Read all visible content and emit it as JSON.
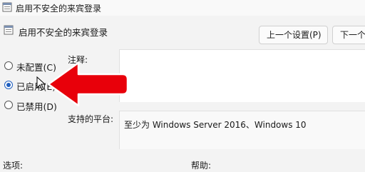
{
  "window": {
    "title": "启用不安全的来宾登录"
  },
  "header": {
    "title": "启用不安全的来宾登录"
  },
  "nav": {
    "prev_label": "上一个设置(P)",
    "next_label": "下一个"
  },
  "state": {
    "options": [
      {
        "label": "未配置(C)",
        "selected": false
      },
      {
        "label": "已启用(E)",
        "selected": true
      },
      {
        "label": "已禁用(D)",
        "selected": false
      }
    ]
  },
  "comment": {
    "label": "注释:",
    "value": ""
  },
  "platform": {
    "label": "支持的平台:",
    "value": "至少为 Windows Server 2016、Windows 10"
  },
  "footer": {
    "options_label": "选项:",
    "help_label": "帮助:"
  },
  "annotation": {
    "arrow_color": "#e8000a"
  },
  "icons": {
    "title_icon": "policy-setting-icon",
    "header_icon": "policy-setting-icon",
    "arrow": "red-arrow-pointer",
    "cursor": "mouse-cursor-icon"
  }
}
